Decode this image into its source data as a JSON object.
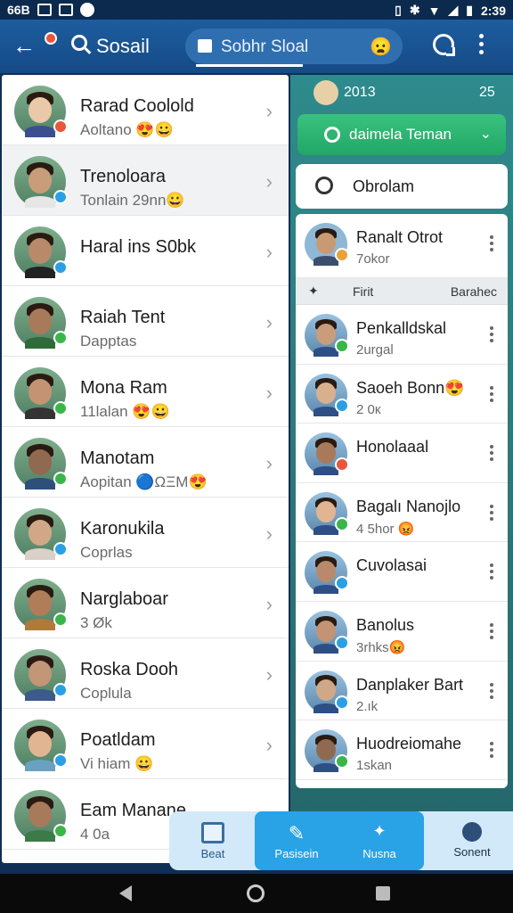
{
  "status": {
    "left_text": "66B",
    "time": "2:39"
  },
  "appbar": {
    "title": "Sosail",
    "tab_label": "Sobhr Sloal",
    "tab_emoji": "😦"
  },
  "chat_list": [
    {
      "name": "Rarad Coolold",
      "sub": "Aoltano 😍😀",
      "badge": "#e8573a",
      "shirt": "#3b4e8f"
    },
    {
      "name": "Trenoloara",
      "sub": "Tonlain 29nn😀",
      "badge": "#2b9fe3",
      "shirt": "#e6e6e6"
    },
    {
      "name": "Haral ins S0bk",
      "sub": "",
      "badge": "#2b9fe3",
      "shirt": "#222"
    },
    {
      "name": "Raiah Tent",
      "sub": "Dapptas",
      "badge": "#3ab54a",
      "shirt": "#2f6a3a"
    },
    {
      "name": "Mona Ram",
      "sub": "11lalan 😍😀",
      "badge": "#3ab54a",
      "shirt": "#333"
    },
    {
      "name": "Manotam",
      "sub": "Aopitan 🔵ΩΞM😍",
      "badge": "#3ab54a",
      "shirt": "#2d4f7a"
    },
    {
      "name": "Karonukila",
      "sub": "Coprlas",
      "badge": "#2b9fe3",
      "shirt": "#d9d0c8"
    },
    {
      "name": "Narglaboar",
      "sub": "3 Øk",
      "badge": "#3ab54a",
      "shirt": "#b07a3a"
    },
    {
      "name": "Roska Dooh",
      "sub": "Coplula",
      "badge": "#2b9fe3",
      "shirt": "#3c5a8a"
    },
    {
      "name": "Poatldam",
      "sub": "Vi hiam 😀",
      "badge": "#2b9fe3",
      "shirt": "#6aa0c0"
    },
    {
      "name": "Eam Manane",
      "sub": "4 0a",
      "badge": "#3ab54a",
      "shirt": "#3c7a4a"
    }
  ],
  "right": {
    "header_year": "2013",
    "header_count": "25",
    "find_friend_label": "daimela Teman",
    "obrolam_label": "Obrolam",
    "first": {
      "name": "Ranalt Otrot",
      "sub": "7okor"
    },
    "divider": {
      "a": "Firit",
      "b": "Barahec"
    },
    "contacts": [
      {
        "name": "Penkalldskal",
        "sub": "2urgal",
        "badge": "#3ab54a"
      },
      {
        "name": "Saoeh Bonn😍",
        "sub": "2 0к",
        "badge": "#2b9fe3"
      },
      {
        "name": "Honolaaal",
        "sub": "",
        "badge": "#e8573a"
      },
      {
        "name": "Bagalı Nanojlo",
        "sub": "4 5hor 😡",
        "badge": "#3ab54a"
      },
      {
        "name": "Cuvolasai",
        "sub": "",
        "badge": "#2b9fe3"
      },
      {
        "name": "Banolus",
        "sub": "3rhks😡",
        "badge": "#2b9fe3"
      },
      {
        "name": "Danplaker Bart",
        "sub": "2.ık",
        "badge": "#2b9fe3"
      },
      {
        "name": "Huodreiomahe",
        "sub": "1skan",
        "badge": "#3ab54a"
      }
    ]
  },
  "bottom_nav": [
    {
      "label": "Beat"
    },
    {
      "label": "Pasisein"
    },
    {
      "label": "Nusna"
    },
    {
      "label": "Sonent"
    }
  ]
}
